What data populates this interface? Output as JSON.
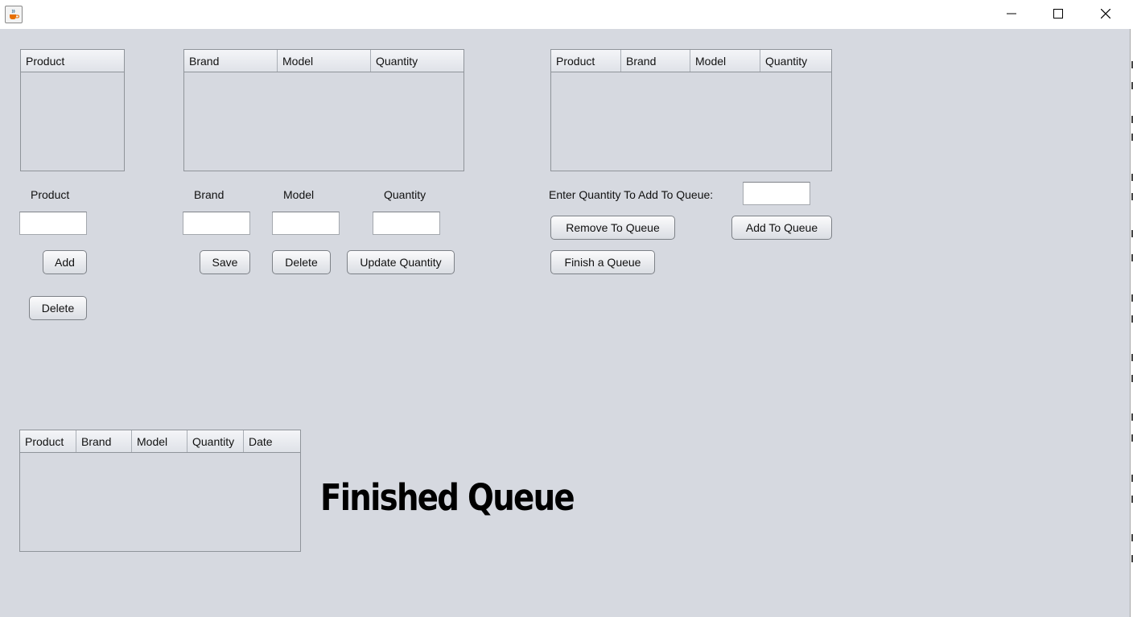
{
  "window": {
    "icon": "java-coffee-cup-icon"
  },
  "products_panel": {
    "headers": [
      "Product"
    ],
    "field_label": "Product",
    "add_label": "Add",
    "delete_label": "Delete"
  },
  "stock_panel": {
    "headers": [
      "Brand",
      "Model",
      "Quantity"
    ],
    "brand_label": "Brand",
    "model_label": "Model",
    "quantity_label": "Quantity",
    "save_label": "Save",
    "delete_label": "Delete",
    "update_label": "Update Quantity"
  },
  "queue_panel": {
    "headers": [
      "Product",
      "Brand",
      "Model",
      "Quantity"
    ],
    "quantity_prompt": "Enter Quantity To Add To Queue:",
    "remove_label": "Remove To Queue",
    "add_label": "Add To Queue",
    "finish_label": "Finish a Queue"
  },
  "finished_panel": {
    "headers": [
      "Product",
      "Brand",
      "Model",
      "Quantity",
      "Date"
    ],
    "title": "Finished Queue"
  },
  "colors": {
    "background": "#d6d9e0",
    "header": "#e8eaef"
  }
}
